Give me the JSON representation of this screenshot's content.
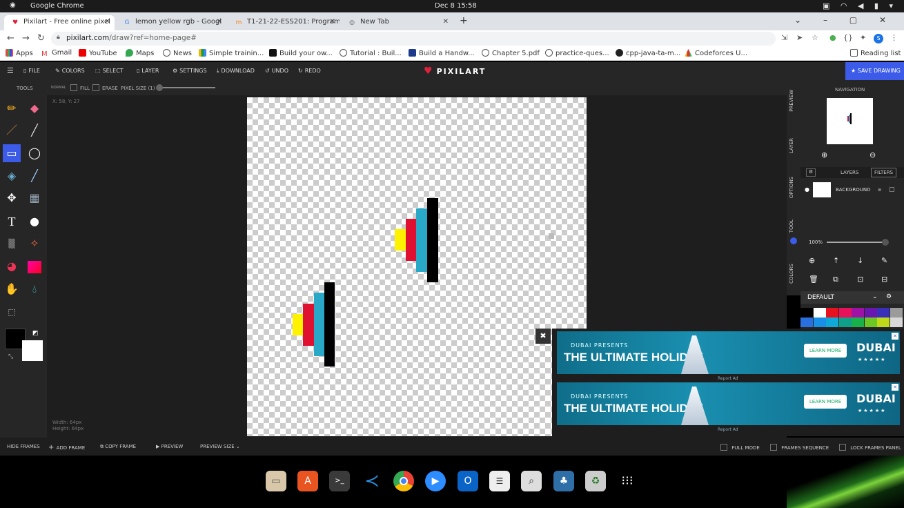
{
  "os": {
    "app_name": "Google Chrome",
    "clock": "Dec 8  15:58"
  },
  "tabs": [
    {
      "title": "Pixilart - Free online pixel",
      "icon": "pixilart-heart-icon"
    },
    {
      "title": "lemon yellow rgb - Googl",
      "icon": "google-icon"
    },
    {
      "title": "T1-21-22-ESS201: Program",
      "icon": "moodle-icon"
    },
    {
      "title": "New Tab",
      "icon": "chrome-icon"
    }
  ],
  "address": {
    "domain": "pixilart.com",
    "path": "/draw?ref=home-page#"
  },
  "bookmarks": [
    "Apps",
    "Gmail",
    "YouTube",
    "Maps",
    "News",
    "Simple trainin...",
    "Build your ow...",
    "Tutorial : Buil...",
    "Build a Handw...",
    "Chapter 5.pdf",
    "practice-ques...",
    "cpp-java-ta-m...",
    "Codeforces U..."
  ],
  "reading_list": "Reading list",
  "pixilart": {
    "menu": [
      "FILE",
      "COLORS",
      "SELECT",
      "LAYER",
      "SETTINGS",
      "DOWNLOAD",
      "UNDO",
      "REDO"
    ],
    "logo": "PIXILART",
    "save": "SAVE DRAWING",
    "tools_title": "TOOLS",
    "options": {
      "fill": "FILL",
      "erase": "ERASE",
      "pixel_size": "PIXEL SIZE (1)",
      "mode": "NORMAL"
    },
    "coords": "X: 58, Y: 27",
    "dims": {
      "width": "Width: 64px",
      "height": "Height: 64px"
    },
    "right_tabs": [
      "PREVIEW",
      "LAYER",
      "OPTIONS",
      "TOOL",
      "COLORS"
    ],
    "navigation_title": "NAVIGATION",
    "layers_title": "LAYERS",
    "filters": "FILTERS",
    "layer_name": "BACKGROUND",
    "opacity": "100%",
    "palette_name": "DEFAULT",
    "palette": [
      "#000000",
      "#ffffff",
      "#e8121e",
      "#e8125a",
      "#a012a6",
      "#6a16b0",
      "#3a2fb8",
      "#9b9b9b",
      "#2a6fe0",
      "#1890e8",
      "#10a8d8",
      "#0ea088",
      "#19b24a",
      "#6cc724",
      "#c0d81a",
      "#d8d8d8"
    ],
    "bottom": {
      "hide_frames": "HIDE FRAMES",
      "add_frame": "ADD FRAME",
      "copy_frame": "COPY FRAME",
      "preview": "PREVIEW",
      "preview_size": "PREVIEW SIZE",
      "full_mode": "FULL MODE",
      "frames_sequence": "FRAMES SEQUENCE",
      "lock_frames": "LOCK FRAMES PANEL"
    }
  },
  "ads": [
    {
      "presents": "DUBAI PRESENTS",
      "headline": "THE ULTIMATE HOLIDAY",
      "cta": "LEARN MORE",
      "brand": "DUBAI",
      "stars": "★★★★★",
      "report": "Report Ad"
    },
    {
      "presents": "DUBAI PRESENTS",
      "headline": "THE ULTIMATE HOLIDAY",
      "cta": "LEARN MORE",
      "brand": "DUBAI",
      "stars": "★★★★★",
      "report": "Report Ad"
    }
  ],
  "colors": {
    "yellow": "#fff200",
    "red": "#e01030",
    "cyan": "#2aa8c8",
    "black": "#000000",
    "accent": "#3b5be8"
  },
  "dock": [
    "files-icon",
    "app-center-icon",
    "terminal-icon",
    "vscode-icon",
    "chrome-icon",
    "zoom-icon",
    "outlook-icon",
    "document-viewer-icon",
    "image-search-icon",
    "photo-app-icon",
    "trash-icon",
    "app-grid-icon"
  ]
}
